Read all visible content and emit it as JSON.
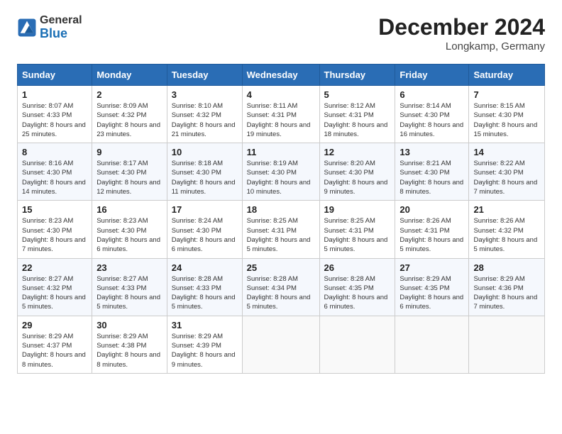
{
  "header": {
    "logo_general": "General",
    "logo_blue": "Blue",
    "month_year": "December 2024",
    "location": "Longkamp, Germany"
  },
  "days_of_week": [
    "Sunday",
    "Monday",
    "Tuesday",
    "Wednesday",
    "Thursday",
    "Friday",
    "Saturday"
  ],
  "weeks": [
    [
      {
        "day": "1",
        "sunrise": "8:07 AM",
        "sunset": "4:33 PM",
        "daylight": "8 hours and 25 minutes."
      },
      {
        "day": "2",
        "sunrise": "8:09 AM",
        "sunset": "4:32 PM",
        "daylight": "8 hours and 23 minutes."
      },
      {
        "day": "3",
        "sunrise": "8:10 AM",
        "sunset": "4:32 PM",
        "daylight": "8 hours and 21 minutes."
      },
      {
        "day": "4",
        "sunrise": "8:11 AM",
        "sunset": "4:31 PM",
        "daylight": "8 hours and 19 minutes."
      },
      {
        "day": "5",
        "sunrise": "8:12 AM",
        "sunset": "4:31 PM",
        "daylight": "8 hours and 18 minutes."
      },
      {
        "day": "6",
        "sunrise": "8:14 AM",
        "sunset": "4:30 PM",
        "daylight": "8 hours and 16 minutes."
      },
      {
        "day": "7",
        "sunrise": "8:15 AM",
        "sunset": "4:30 PM",
        "daylight": "8 hours and 15 minutes."
      }
    ],
    [
      {
        "day": "8",
        "sunrise": "8:16 AM",
        "sunset": "4:30 PM",
        "daylight": "8 hours and 14 minutes."
      },
      {
        "day": "9",
        "sunrise": "8:17 AM",
        "sunset": "4:30 PM",
        "daylight": "8 hours and 12 minutes."
      },
      {
        "day": "10",
        "sunrise": "8:18 AM",
        "sunset": "4:30 PM",
        "daylight": "8 hours and 11 minutes."
      },
      {
        "day": "11",
        "sunrise": "8:19 AM",
        "sunset": "4:30 PM",
        "daylight": "8 hours and 10 minutes."
      },
      {
        "day": "12",
        "sunrise": "8:20 AM",
        "sunset": "4:30 PM",
        "daylight": "8 hours and 9 minutes."
      },
      {
        "day": "13",
        "sunrise": "8:21 AM",
        "sunset": "4:30 PM",
        "daylight": "8 hours and 8 minutes."
      },
      {
        "day": "14",
        "sunrise": "8:22 AM",
        "sunset": "4:30 PM",
        "daylight": "8 hours and 7 minutes."
      }
    ],
    [
      {
        "day": "15",
        "sunrise": "8:23 AM",
        "sunset": "4:30 PM",
        "daylight": "8 hours and 7 minutes."
      },
      {
        "day": "16",
        "sunrise": "8:23 AM",
        "sunset": "4:30 PM",
        "daylight": "8 hours and 6 minutes."
      },
      {
        "day": "17",
        "sunrise": "8:24 AM",
        "sunset": "4:30 PM",
        "daylight": "8 hours and 6 minutes."
      },
      {
        "day": "18",
        "sunrise": "8:25 AM",
        "sunset": "4:31 PM",
        "daylight": "8 hours and 5 minutes."
      },
      {
        "day": "19",
        "sunrise": "8:25 AM",
        "sunset": "4:31 PM",
        "daylight": "8 hours and 5 minutes."
      },
      {
        "day": "20",
        "sunrise": "8:26 AM",
        "sunset": "4:31 PM",
        "daylight": "8 hours and 5 minutes."
      },
      {
        "day": "21",
        "sunrise": "8:26 AM",
        "sunset": "4:32 PM",
        "daylight": "8 hours and 5 minutes."
      }
    ],
    [
      {
        "day": "22",
        "sunrise": "8:27 AM",
        "sunset": "4:32 PM",
        "daylight": "8 hours and 5 minutes."
      },
      {
        "day": "23",
        "sunrise": "8:27 AM",
        "sunset": "4:33 PM",
        "daylight": "8 hours and 5 minutes."
      },
      {
        "day": "24",
        "sunrise": "8:28 AM",
        "sunset": "4:33 PM",
        "daylight": "8 hours and 5 minutes."
      },
      {
        "day": "25",
        "sunrise": "8:28 AM",
        "sunset": "4:34 PM",
        "daylight": "8 hours and 5 minutes."
      },
      {
        "day": "26",
        "sunrise": "8:28 AM",
        "sunset": "4:35 PM",
        "daylight": "8 hours and 6 minutes."
      },
      {
        "day": "27",
        "sunrise": "8:29 AM",
        "sunset": "4:35 PM",
        "daylight": "8 hours and 6 minutes."
      },
      {
        "day": "28",
        "sunrise": "8:29 AM",
        "sunset": "4:36 PM",
        "daylight": "8 hours and 7 minutes."
      }
    ],
    [
      {
        "day": "29",
        "sunrise": "8:29 AM",
        "sunset": "4:37 PM",
        "daylight": "8 hours and 8 minutes."
      },
      {
        "day": "30",
        "sunrise": "8:29 AM",
        "sunset": "4:38 PM",
        "daylight": "8 hours and 8 minutes."
      },
      {
        "day": "31",
        "sunrise": "8:29 AM",
        "sunset": "4:39 PM",
        "daylight": "8 hours and 9 minutes."
      },
      null,
      null,
      null,
      null
    ]
  ],
  "labels": {
    "sunrise": "Sunrise:",
    "sunset": "Sunset:",
    "daylight": "Daylight:"
  }
}
